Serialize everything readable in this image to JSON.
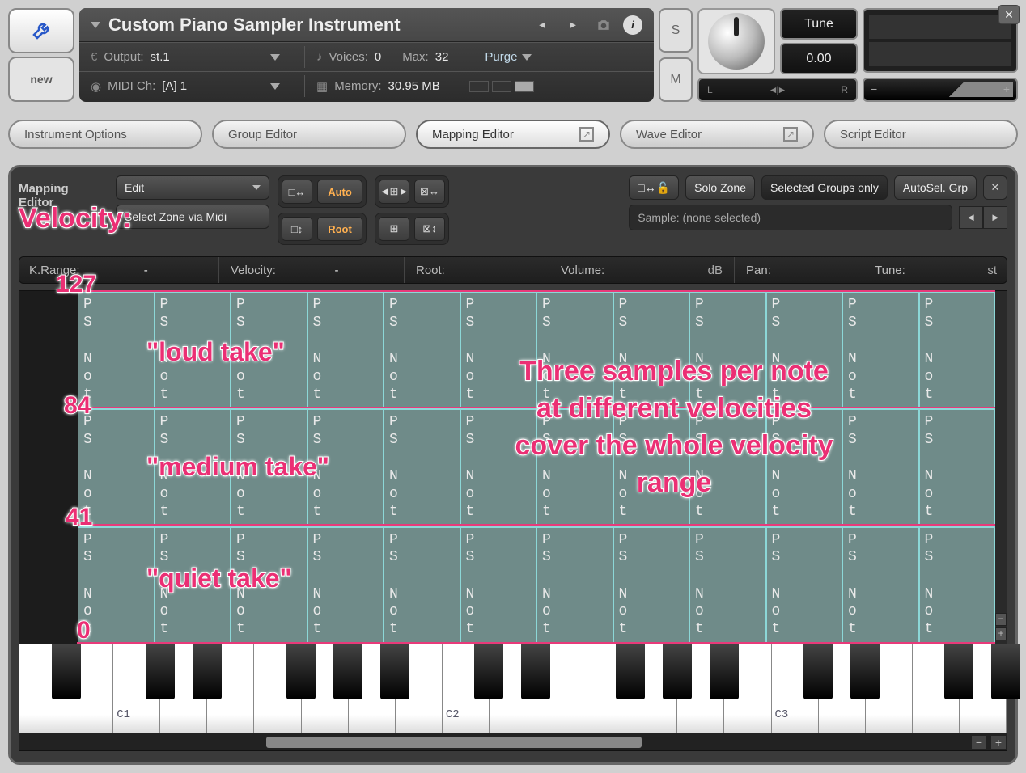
{
  "header": {
    "new_label": "new",
    "instrument_name": "Custom Piano Sampler Instrument",
    "output_label": "Output:",
    "output_value": "st.1",
    "voices_label": "Voices:",
    "voices_value": "0",
    "max_label": "Max:",
    "max_value": "32",
    "midi_label": "MIDI Ch:",
    "midi_value": "[A]  1",
    "memory_label": "Memory:",
    "memory_value": "30.95 MB",
    "purge_label": "Purge",
    "solo": "S",
    "mute": "M",
    "tune_label": "Tune",
    "tune_value": "0.00",
    "pan_left": "L",
    "pan_right": "R"
  },
  "tabs": {
    "options": "Instrument Options",
    "group": "Group Editor",
    "mapping": "Mapping Editor",
    "wave": "Wave Editor",
    "script": "Script Editor"
  },
  "editor": {
    "title1": "Mapping",
    "title2": "Editor",
    "edit_menu": "Edit",
    "auto": "Auto",
    "root": "Root",
    "select_midi": "Select Zone via Midi",
    "lock_btn": "□↔🔓",
    "solo_zone": "Solo Zone",
    "sel_groups": "Selected Groups only",
    "autosel": "AutoSel. Grp",
    "sample_label": "Sample:",
    "sample_value": "(none selected)",
    "info": {
      "krange": "K.Range:",
      "krange_val": "-",
      "velocity": "Velocity:",
      "velocity_val": "-",
      "root": "Root:",
      "volume": "Volume:",
      "volume_unit": "dB",
      "pan": "Pan:",
      "tune": "Tune:",
      "tune_unit": "st"
    }
  },
  "zone_text": {
    "c1": "P",
    "c2": "S",
    "c3": "N",
    "c4": "o",
    "c5": "t"
  },
  "keyboard": {
    "labels": [
      "C1",
      "C2",
      "C3"
    ]
  },
  "annotations": {
    "velocity_title": "Velocity:",
    "v127": "127",
    "v84": "84",
    "v41": "41",
    "v0": "0",
    "loud": "\"loud take\"",
    "medium": "\"medium take\"",
    "quiet": "\"quiet take\"",
    "desc_l1": "Three samples per note",
    "desc_l2": "at different velocities",
    "desc_l3": "cover the whole velocity",
    "desc_l4": "range"
  }
}
